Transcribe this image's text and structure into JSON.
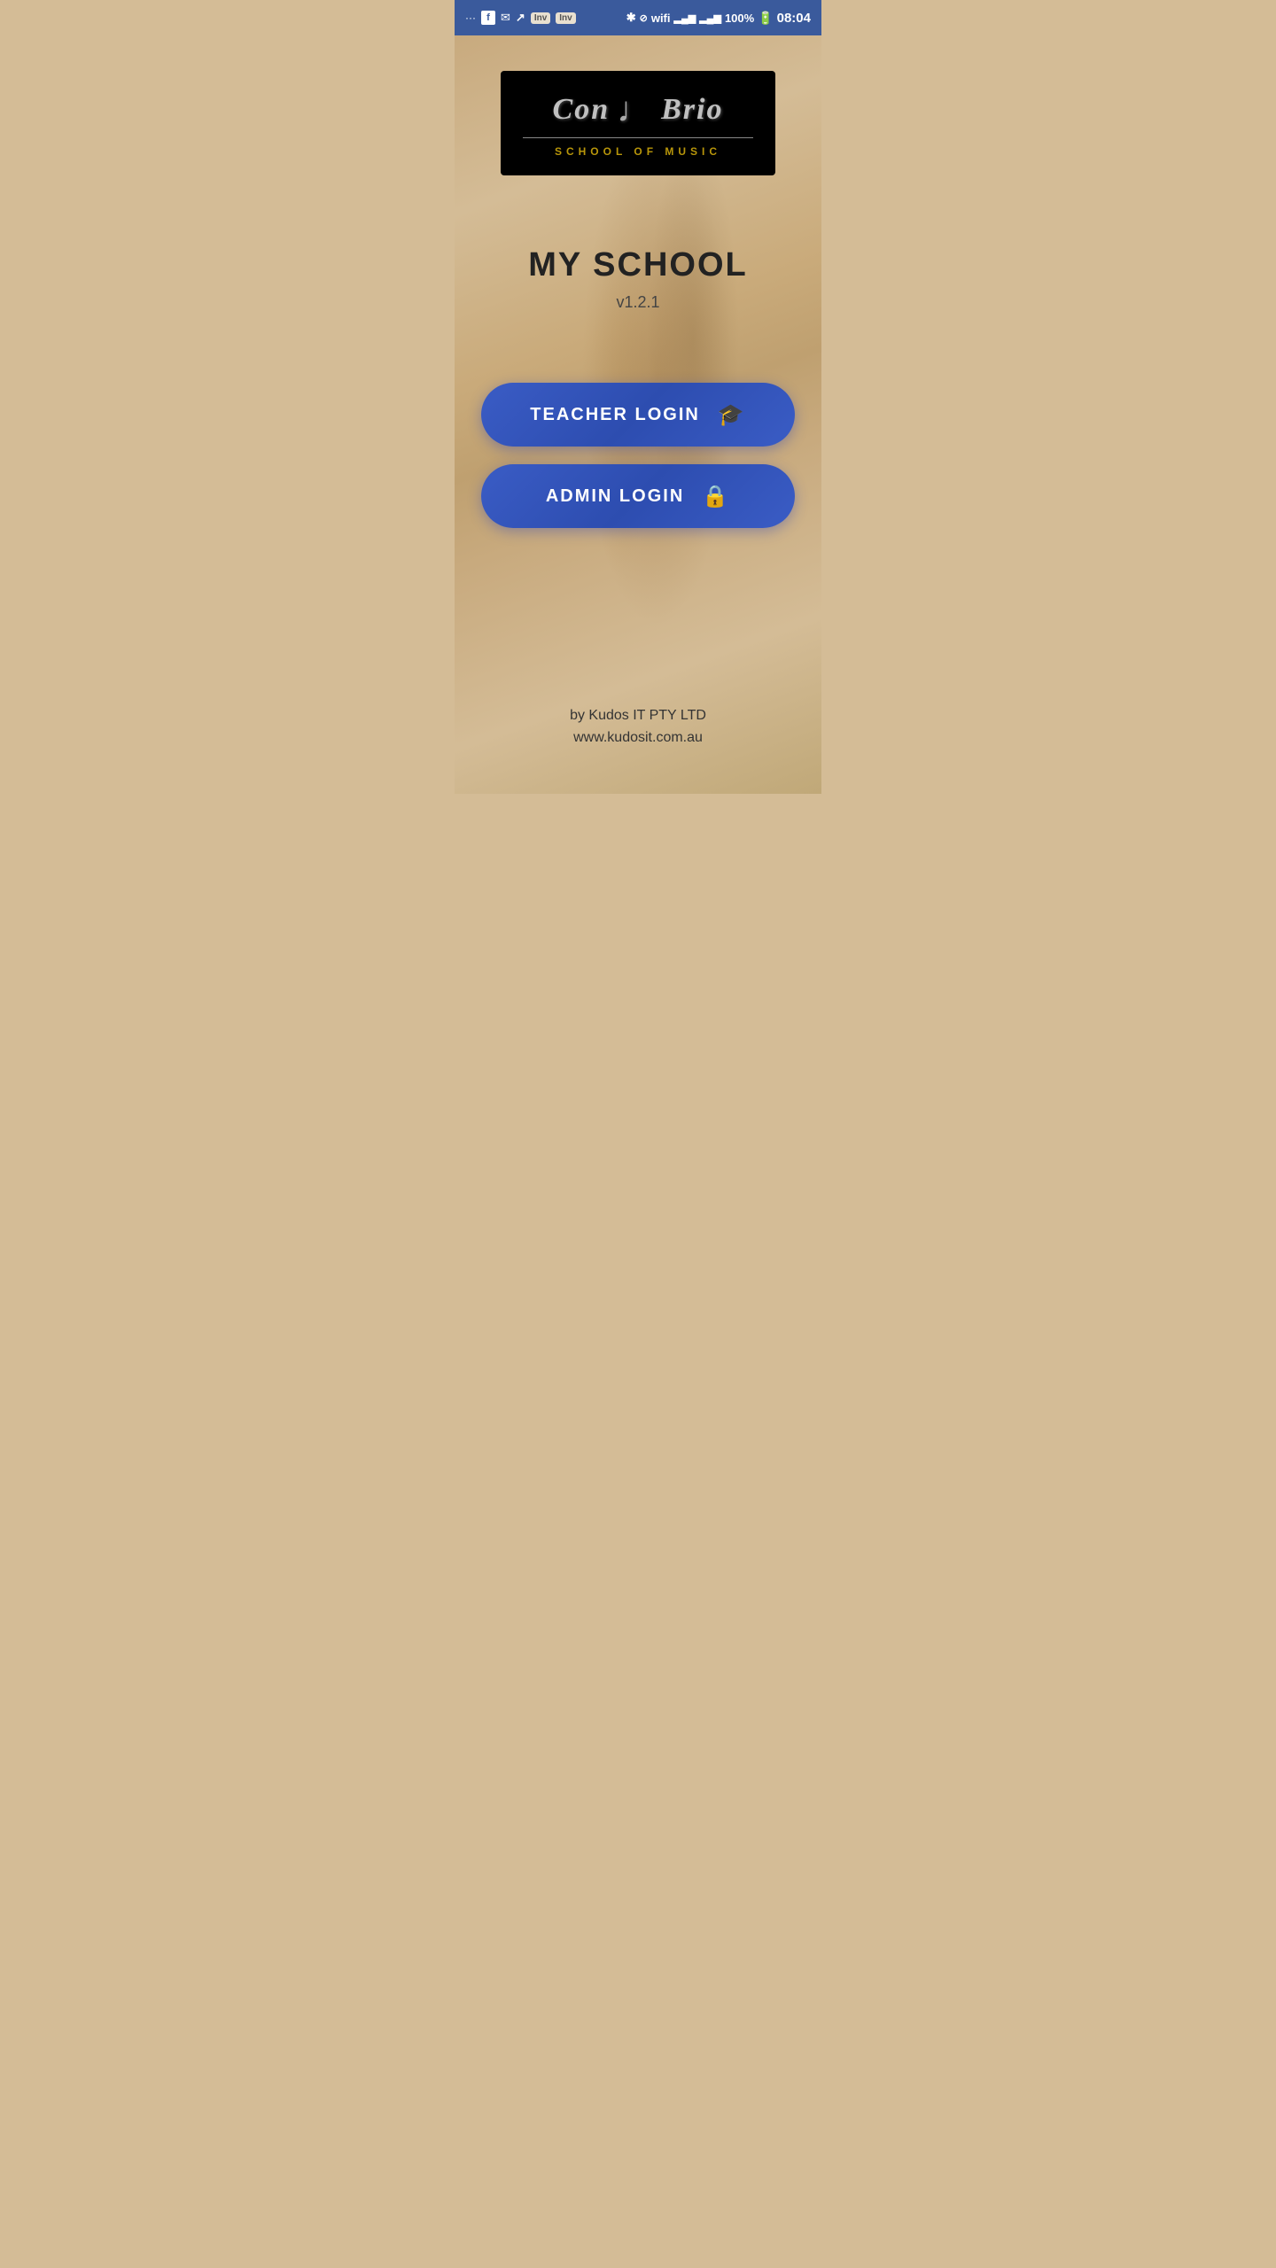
{
  "statusBar": {
    "time": "08:04",
    "battery": "100%",
    "notificationIcons": [
      "dots",
      "facebook",
      "mail",
      "chart",
      "inv1",
      "inv2"
    ],
    "inv1": "Inv",
    "inv2": "Inv"
  },
  "logo": {
    "title_left": "Con",
    "title_right": "Brio",
    "note_symbol": "♩",
    "subtitle": "SCHOOL OF MUSIC",
    "alt_text": "Con Brio School of Music"
  },
  "app": {
    "title": "MY SCHOOL",
    "version": "v1.2.1"
  },
  "buttons": {
    "teacher_login": "TEACHER LOGIN",
    "admin_login": "ADMIN LOGIN"
  },
  "footer": {
    "line1": "by Kudos IT PTY LTD",
    "line2": "www.kudosit.com.au"
  },
  "colors": {
    "button_bg": "#3a5cc5",
    "status_bar_bg": "#3a5a9c",
    "background": "#d4bc96"
  }
}
